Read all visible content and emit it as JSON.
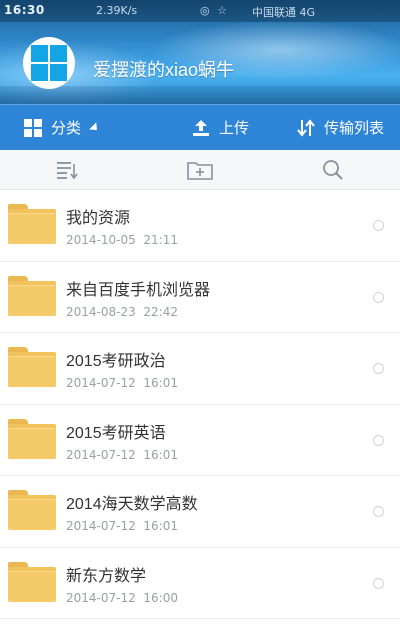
{
  "status_bar": {
    "time": "16:30",
    "speed": "2.39K/s",
    "carrier": "中国联通 4G"
  },
  "header": {
    "username": "爱摆渡的xiao蜗牛",
    "avatar_icon": "windows-logo-icon"
  },
  "toolbar": {
    "category_label": "分类",
    "upload_label": "上传",
    "transfer_label": "传输列表"
  },
  "subbar": {
    "icons": [
      "sort-icon",
      "new-folder-icon",
      "search-icon"
    ]
  },
  "files": [
    {
      "name": "我的资源",
      "date": "2014-10-05",
      "time": "21:11"
    },
    {
      "name": "来自百度手机浏览器",
      "date": "2014-08-23",
      "time": "22:42"
    },
    {
      "name": "2015考研政治",
      "date": "2014-07-12",
      "time": "16:01"
    },
    {
      "name": "2015考研英语",
      "date": "2014-07-12",
      "time": "16:01"
    },
    {
      "name": "2014海天数学高数",
      "date": "2014-07-12",
      "time": "16:01"
    },
    {
      "name": "新东方数学",
      "date": "2014-07-12",
      "time": "16:00"
    }
  ],
  "colors": {
    "toolbar_blue": "#2e84d6",
    "folder_yellow": "#f2c35c",
    "date_gray": "#9aa0a6"
  }
}
